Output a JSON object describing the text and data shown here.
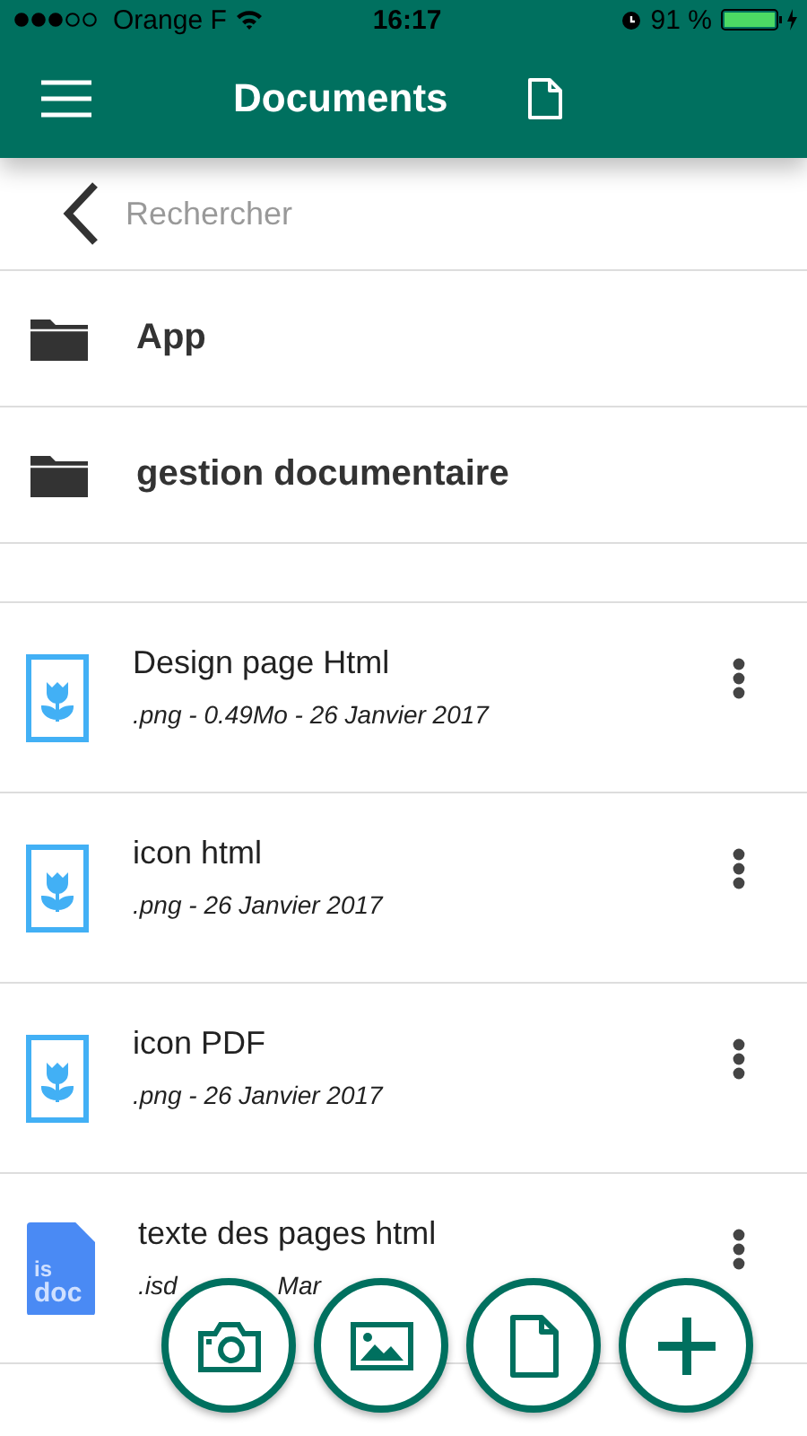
{
  "status_bar": {
    "carrier": "Orange F",
    "time": "16:17",
    "battery_text": "91 %"
  },
  "header": {
    "title": "Documents"
  },
  "search": {
    "placeholder": "Rechercher"
  },
  "folders": [
    {
      "name": "App"
    },
    {
      "name": "gestion documentaire"
    }
  ],
  "files": [
    {
      "kind": "image",
      "name": "Design page Html",
      "meta": [
        ".png - 0.49Mo - 26 Janvier 2017"
      ]
    },
    {
      "kind": "image",
      "name": "icon html",
      "meta": [
        ".png - 26 Janvier 2017"
      ]
    },
    {
      "kind": "image",
      "name": "icon PDF",
      "meta": [
        ".png - 26 Janvier 2017"
      ]
    },
    {
      "kind": "isdoc",
      "name": "texte des pages html",
      "icon_label": [
        "is",
        "doc"
      ],
      "meta": [
        ".isd",
        "Mar"
      ]
    }
  ],
  "actions": [
    {
      "kind": "camera"
    },
    {
      "kind": "image"
    },
    {
      "kind": "file"
    },
    {
      "kind": "add"
    }
  ]
}
